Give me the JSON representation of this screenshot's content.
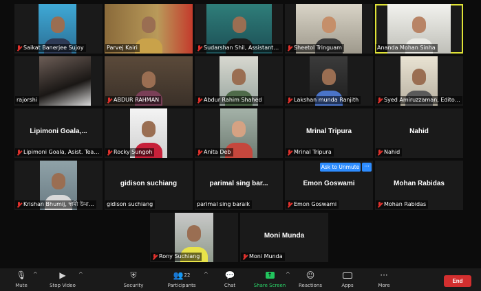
{
  "participants": [
    {
      "name": "Saikat Banerjee Sujoy",
      "bigname": "",
      "muted": true
    },
    {
      "name": "Parvej Kairi",
      "bigname": "",
      "muted": false
    },
    {
      "name": "Sudarshan Shil, Assistant ...",
      "bigname": "",
      "muted": true
    },
    {
      "name": "Sheetol Tringuam",
      "bigname": "",
      "muted": true
    },
    {
      "name": "Ananda Mohan Sinha",
      "bigname": "",
      "muted": false
    },
    {
      "name": "rajorshi",
      "bigname": "",
      "muted": false
    },
    {
      "name": "ABDUR RAHMAN",
      "bigname": "",
      "muted": true
    },
    {
      "name": "Abdur Rahim Shahed",
      "bigname": "",
      "muted": true
    },
    {
      "name": "Lakshan munda Ranjith",
      "bigname": "",
      "muted": true
    },
    {
      "name": "Syed Amiruzzaman, Editor,...",
      "bigname": "",
      "muted": true
    },
    {
      "name": "Lipimoni Goala, Asist. Teac...",
      "bigname": "Lipimoni Goala,...",
      "muted": true
    },
    {
      "name": "Rocky Sungoh",
      "bigname": "",
      "muted": true
    },
    {
      "name": "Anita Deb",
      "bigname": "",
      "muted": true
    },
    {
      "name": "Mrinal Tripura",
      "bigname": "Mrinal Tripura",
      "muted": true
    },
    {
      "name": "Nahid",
      "bigname": "Nahid",
      "muted": true
    },
    {
      "name": "Krishan Bhumij, স্বামী উমা...",
      "bigname": "",
      "muted": true
    },
    {
      "name": "gidison suchiang",
      "bigname": "gidison suchiang",
      "muted": false
    },
    {
      "name": "parimal sing baraik",
      "bigname": "parimal sing bar...",
      "muted": false
    },
    {
      "name": "Emon Goswami",
      "bigname": "Emon Goswami",
      "muted": true
    },
    {
      "name": "Mohan Rabidas",
      "bigname": "Mohan Rabidas",
      "muted": true
    },
    {
      "name": "Rony Suchiang",
      "bigname": "",
      "muted": true
    },
    {
      "name": "Moni Munda",
      "bigname": "Moni Munda",
      "muted": true
    }
  ],
  "overlay": {
    "ask_to_unmute": "Ask to Unmute",
    "more": "···"
  },
  "toolbar": {
    "mute": "Mute",
    "stop_video": "Stop Video",
    "security": "Security",
    "participants": "Participants",
    "participants_count": "22",
    "chat": "Chat",
    "share_screen": "Share Screen",
    "reactions": "Reactions",
    "apps": "Apps",
    "more": "More",
    "end": "End"
  },
  "colors": {
    "active_speaker": "#dfe236",
    "muted_mic": "#e0312c",
    "end_button": "#d32f2f",
    "share_green": "#22c55e",
    "ask_button": "#2d8cff"
  }
}
